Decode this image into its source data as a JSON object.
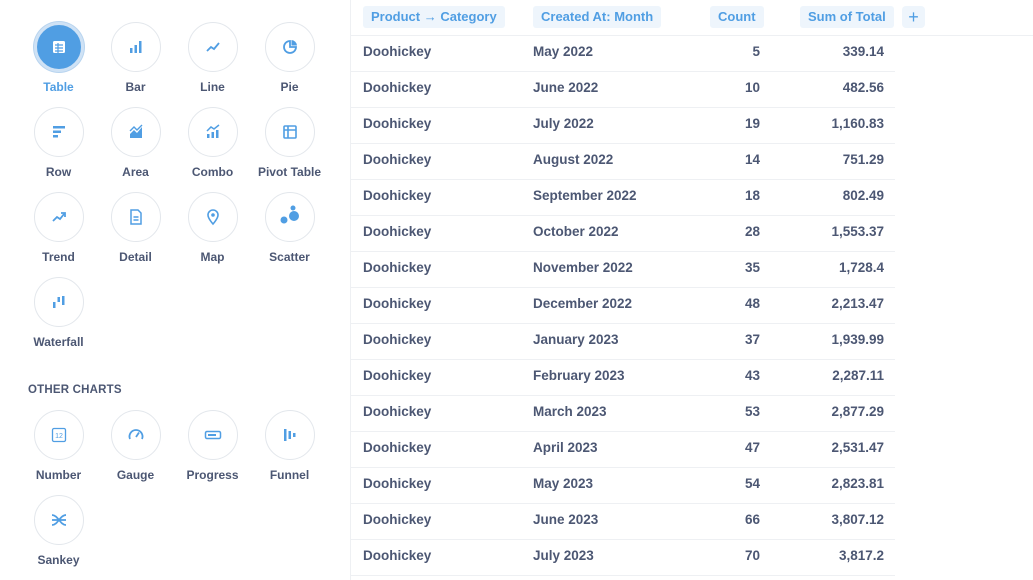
{
  "viz_picker": {
    "main": [
      {
        "label": "Table",
        "icon": "table-icon",
        "active": true
      },
      {
        "label": "Bar",
        "icon": "bar-icon"
      },
      {
        "label": "Line",
        "icon": "line-icon"
      },
      {
        "label": "Pie",
        "icon": "pie-icon"
      },
      {
        "label": "Row",
        "icon": "row-icon"
      },
      {
        "label": "Area",
        "icon": "area-icon"
      },
      {
        "label": "Combo",
        "icon": "combo-icon"
      },
      {
        "label": "Pivot Table",
        "icon": "pivot-table-icon"
      },
      {
        "label": "Trend",
        "icon": "trend-icon"
      },
      {
        "label": "Detail",
        "icon": "detail-icon"
      },
      {
        "label": "Map",
        "icon": "map-icon"
      },
      {
        "label": "Scatter",
        "icon": "scatter-icon"
      },
      {
        "label": "Waterfall",
        "icon": "waterfall-icon"
      }
    ],
    "other_title": "OTHER CHARTS",
    "other": [
      {
        "label": "Number",
        "icon": "number-icon"
      },
      {
        "label": "Gauge",
        "icon": "gauge-icon"
      },
      {
        "label": "Progress",
        "icon": "progress-icon"
      },
      {
        "label": "Funnel",
        "icon": "funnel-icon"
      },
      {
        "label": "Sankey",
        "icon": "sankey-icon"
      }
    ]
  },
  "table": {
    "columns": [
      "Product → Category",
      "Created At: Month",
      "Count",
      "Sum of Total"
    ],
    "rows": [
      [
        "Doohickey",
        "May 2022",
        "5",
        "339.14"
      ],
      [
        "Doohickey",
        "June 2022",
        "10",
        "482.56"
      ],
      [
        "Doohickey",
        "July 2022",
        "19",
        "1,160.83"
      ],
      [
        "Doohickey",
        "August 2022",
        "14",
        "751.29"
      ],
      [
        "Doohickey",
        "September 2022",
        "18",
        "802.49"
      ],
      [
        "Doohickey",
        "October 2022",
        "28",
        "1,553.37"
      ],
      [
        "Doohickey",
        "November 2022",
        "35",
        "1,728.4"
      ],
      [
        "Doohickey",
        "December 2022",
        "48",
        "2,213.47"
      ],
      [
        "Doohickey",
        "January 2023",
        "37",
        "1,939.99"
      ],
      [
        "Doohickey",
        "February 2023",
        "43",
        "2,287.11"
      ],
      [
        "Doohickey",
        "March 2023",
        "53",
        "2,877.29"
      ],
      [
        "Doohickey",
        "April 2023",
        "47",
        "2,531.47"
      ],
      [
        "Doohickey",
        "May 2023",
        "54",
        "2,823.81"
      ],
      [
        "Doohickey",
        "June 2023",
        "66",
        "3,807.12"
      ],
      [
        "Doohickey",
        "July 2023",
        "70",
        "3,817.2"
      ]
    ],
    "add_column_label": "+"
  },
  "colors": {
    "accent": "#509ee3",
    "text": "#4c5773",
    "border": "#eef0f3"
  }
}
